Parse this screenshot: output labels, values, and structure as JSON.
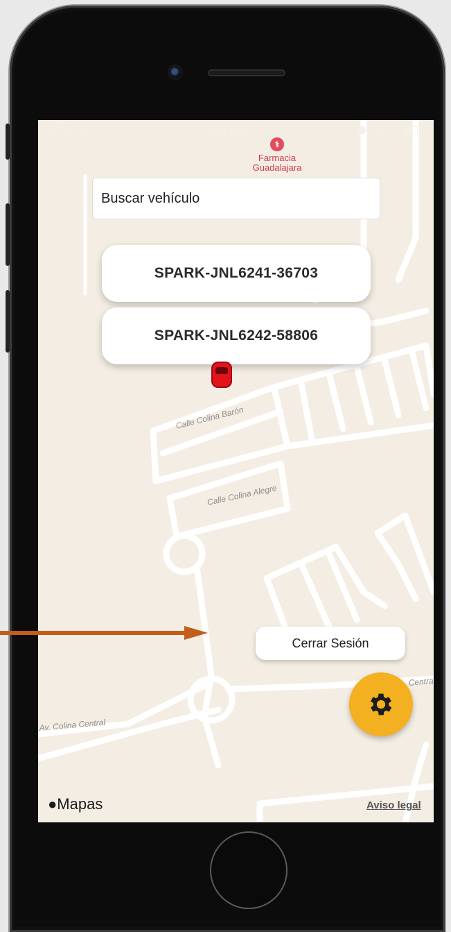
{
  "status_bar": {
    "carrier": "AT&T 4G",
    "time": "2:42 p.m.",
    "battery": "54 %"
  },
  "map": {
    "poi_name": "Farmacia Guadalajara",
    "streets": [
      "Calle Colina Barón",
      "Calle Colina Alegre",
      "Av. Colina Central",
      "Central"
    ],
    "brand": "Mapas",
    "legal": "Aviso legal"
  },
  "search": {
    "placeholder": "Buscar vehículo"
  },
  "vehicles": [
    {
      "label": "SPARK-JNL6241-36703"
    },
    {
      "label": "SPARK-JNL6242-58806"
    }
  ],
  "logout": {
    "label": "Cerrar Sesión"
  },
  "settings": {
    "icon": "gear-icon"
  },
  "colors": {
    "accent": "#f3b021",
    "annotation_arrow": "#c35d1a",
    "vehicle_marker": "#e3131c",
    "poi": "#e44b5c"
  }
}
